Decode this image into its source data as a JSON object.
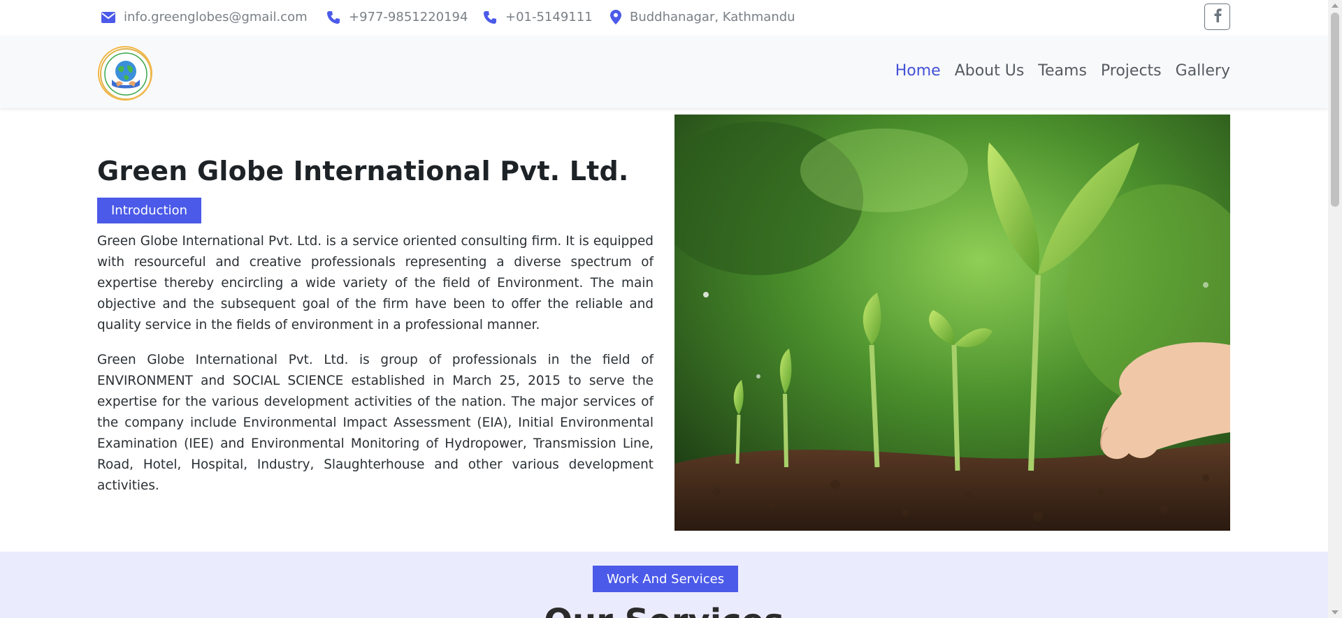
{
  "topbar": {
    "email": "info.greenglobes@gmail.com",
    "phone1": "+977-9851220194",
    "phone2": "+01-5149111",
    "address": "Buddhanagar, Kathmandu",
    "icons": [
      "envelope-icon",
      "phone-icon",
      "phone-icon",
      "map-pin-icon",
      "facebook-icon"
    ]
  },
  "navbar": {
    "items": [
      {
        "label": "Home",
        "active": true
      },
      {
        "label": "About Us"
      },
      {
        "label": "Teams"
      },
      {
        "label": "Projects"
      },
      {
        "label": "Gallery"
      }
    ]
  },
  "hero": {
    "title": "Green Globe International Pvt. Ltd.",
    "badge": "Introduction",
    "paragraph1": "Green Globe International Pvt. Ltd. is a service oriented consulting firm. It is equipped with resourceful and creative professionals representing a diverse spectrum of expertise thereby encircling a wide variety of the field of Environment. The main objective and the subsequent goal of the firm have been to offer the reliable and quality service in the fields of environment in a professional manner.",
    "paragraph2": "Green Globe International Pvt. Ltd. is group of professionals in the field of ENVIRONMENT and SOCIAL SCIENCE established in March 25, 2015 to serve the expertise for the various development activities of the nation. The major services of the company include Environmental Impact Assessment (EIA), Initial Environmental Examination (IEE) and Environmental Monitoring of Hydropower, Transmission Line, Road, Hotel, Hospital, Industry, Slaughterhouse and other various development activities."
  },
  "services": {
    "badge": "Work And Services",
    "title": "Our Services"
  },
  "colors": {
    "accent": "#4b5ae8",
    "nav_active": "#4351d8",
    "services_bg": "#ebebfe"
  }
}
